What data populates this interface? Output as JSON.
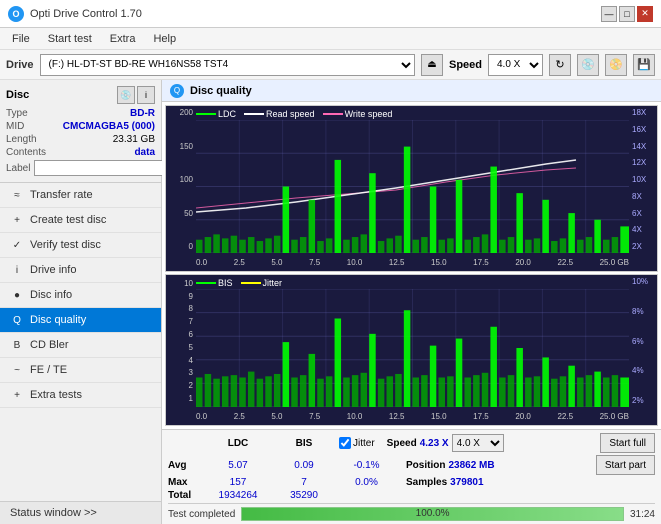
{
  "app": {
    "title": "Opti Drive Control 1.70",
    "logo_char": "O"
  },
  "titlebar": {
    "minimize": "—",
    "maximize": "□",
    "close": "✕"
  },
  "menubar": {
    "items": [
      "File",
      "Start test",
      "Extra",
      "Help"
    ]
  },
  "toolbar": {
    "drive_label": "Drive",
    "drive_value": "(F:)  HL-DT-ST BD-RE  WH16NS58 TST4",
    "speed_label": "Speed",
    "speed_value": "4.0 X"
  },
  "disc": {
    "title": "Disc",
    "type_label": "Type",
    "type_value": "BD-R",
    "mid_label": "MID",
    "mid_value": "CMCMAGBA5 (000)",
    "length_label": "Length",
    "length_value": "23.31 GB",
    "contents_label": "Contents",
    "contents_value": "data",
    "label_label": "Label"
  },
  "nav": {
    "items": [
      {
        "id": "transfer-rate",
        "label": "Transfer rate",
        "icon": "≈"
      },
      {
        "id": "create-test-disc",
        "label": "Create test disc",
        "icon": "+"
      },
      {
        "id": "verify-test-disc",
        "label": "Verify test disc",
        "icon": "✓"
      },
      {
        "id": "drive-info",
        "label": "Drive info",
        "icon": "i"
      },
      {
        "id": "disc-info",
        "label": "Disc info",
        "icon": "●"
      },
      {
        "id": "disc-quality",
        "label": "Disc quality",
        "icon": "Q",
        "active": true
      },
      {
        "id": "cd-bler",
        "label": "CD Bler",
        "icon": "B"
      },
      {
        "id": "fe-te",
        "label": "FE / TE",
        "icon": "~"
      },
      {
        "id": "extra-tests",
        "label": "Extra tests",
        "icon": "+"
      }
    ],
    "status_window": "Status window >>"
  },
  "disc_quality": {
    "title": "Disc quality",
    "chart1": {
      "legend": [
        "LDC",
        "Read speed",
        "Write speed"
      ],
      "y_labels_left": [
        "200",
        "150",
        "100",
        "50",
        "0"
      ],
      "y_labels_right": [
        "18X",
        "16X",
        "14X",
        "12X",
        "10X",
        "8X",
        "6X",
        "4X",
        "2X"
      ],
      "x_labels": [
        "0.0",
        "2.5",
        "5.0",
        "7.5",
        "10.0",
        "12.5",
        "15.0",
        "17.5",
        "20.0",
        "22.5",
        "25.0 GB"
      ]
    },
    "chart2": {
      "legend": [
        "BIS",
        "Jitter"
      ],
      "y_labels_left": [
        "10",
        "9",
        "8",
        "7",
        "6",
        "5",
        "4",
        "3",
        "2",
        "1"
      ],
      "y_labels_right": [
        "10%",
        "8%",
        "6%",
        "4%",
        "2%"
      ],
      "x_labels": [
        "0.0",
        "2.5",
        "5.0",
        "7.5",
        "10.0",
        "12.5",
        "15.0",
        "17.5",
        "20.0",
        "22.5",
        "25.0 GB"
      ]
    }
  },
  "stats": {
    "col_ldc": "LDC",
    "col_bis": "BIS",
    "col_jitter": "Jitter",
    "speed_label": "Speed",
    "speed_value": "4.23 X",
    "speed_select": "4.0 X",
    "avg_label": "Avg",
    "avg_ldc": "5.07",
    "avg_bis": "0.09",
    "avg_jitter": "-0.1%",
    "max_label": "Max",
    "max_ldc": "157",
    "max_bis": "7",
    "max_jitter": "0.0%",
    "total_label": "Total",
    "total_ldc": "1934264",
    "total_bis": "35290",
    "position_label": "Position",
    "position_value": "23862 MB",
    "samples_label": "Samples",
    "samples_value": "379801",
    "start_full": "Start full",
    "start_part": "Start part",
    "jitter_checked": true,
    "jitter_label": "Jitter"
  },
  "progress": {
    "percent": "100.0%",
    "fill_width": "100",
    "status": "Test completed",
    "time": "31:24"
  },
  "colors": {
    "ldc_color": "#00ff00",
    "read_speed_color": "#ffffff",
    "write_speed_color": "#ff69b4",
    "bis_color": "#00ff00",
    "jitter_color": "#ffff00",
    "chart_bg": "#1a1a3e",
    "active_nav": "#0078d7"
  }
}
